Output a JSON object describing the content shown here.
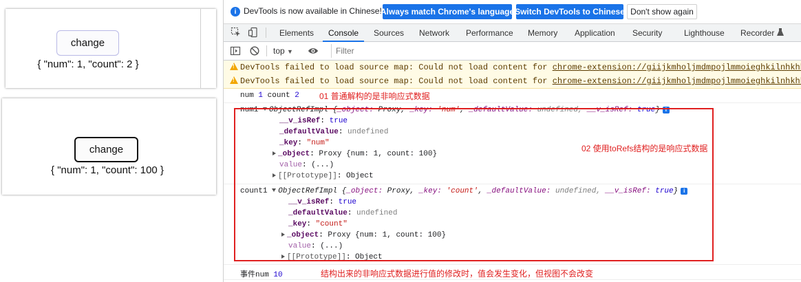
{
  "app": {
    "panel1": {
      "button_label": "change",
      "state_text": "{ \"num\": 1, \"count\": 2 }"
    },
    "panel2": {
      "button_label": "change",
      "state_text": "{ \"num\": 1, \"count\": 100 }"
    }
  },
  "devtools": {
    "infobar": {
      "message": "DevTools is now available in Chinese!",
      "btn_match": "Always match Chrome's language",
      "btn_switch": "Switch DevTools to Chinese",
      "btn_dismiss": "Don't show again"
    },
    "tabs": [
      "Elements",
      "Console",
      "Sources",
      "Network",
      "Performance",
      "Memory",
      "Application",
      "Security",
      "Lighthouse",
      "Recorder"
    ],
    "active_tab": "Console",
    "toolbar": {
      "context": "top",
      "filter_placeholder": "Filter"
    },
    "warnings": [
      {
        "prefix": "DevTools failed to load source map: Could not load content for ",
        "link": "chrome-extension://giijkmholjmdmpojlmmoieghkilnhkhb/static/js"
      },
      {
        "prefix": "DevTools failed to load source map: Could not load content for ",
        "link": "chrome-extension://giijkmholjmdmpojlmmoieghkilnhkhb/static/js"
      }
    ],
    "log1": {
      "label_num": "num",
      "num_val": "1",
      "label_count": "count",
      "count_val": "2"
    },
    "num1": {
      "label": "num1",
      "summary_class": "ObjectRefImpl",
      "summary_obj": "_object:",
      "summary_proxy": "Proxy,",
      "summary_key": "_key:",
      "summary_key_val": "'num'",
      "summary_default": "_defaultValue:",
      "summary_default_val": "undefined,",
      "summary_isref": "__v_isRef:",
      "summary_isref_val": "true",
      "isref_key": "__v_isRef",
      "isref_val": "true",
      "default_key": "_defaultValue",
      "default_val": "undefined",
      "key_key": "_key",
      "key_val": "\"num\"",
      "object_key": "_object",
      "object_val": "Proxy {num: 1, count: 100}",
      "value_key": "value",
      "value_val": "(...)",
      "proto_key": "[[Prototype]]",
      "proto_val": "Object"
    },
    "count1": {
      "label": "count1",
      "summary_class": "ObjectRefImpl",
      "summary_obj": "_object:",
      "summary_proxy": "Proxy,",
      "summary_key": "_key:",
      "summary_key_val": "'count'",
      "summary_default": "_defaultValue:",
      "summary_default_val": "undefined,",
      "summary_isref": "__v_isRef:",
      "summary_isref_val": "true",
      "isref_key": "__v_isRef",
      "isref_val": "true",
      "default_key": "_defaultValue",
      "default_val": "undefined",
      "key_key": "_key",
      "key_val": "\"count\"",
      "object_key": "_object",
      "object_val": "Proxy {num: 1, count: 100}",
      "value_key": "value",
      "value_val": "(...)",
      "proto_key": "[[Prototype]]",
      "proto_val": "Object"
    },
    "log_event": {
      "label": "事件num",
      "val": "10"
    },
    "annotations": {
      "a1": "01    普通解构的是非响应式数据",
      "a2": "02 使用toRefs结构的是响应式数据",
      "a3": "结构出来的非响应式数据进行值的修改时，值会发生变化，但视图不会改变"
    },
    "colors": {
      "accent": "#1a73e8",
      "annotation": "#e02020",
      "warning_bg": "#fffbe5"
    }
  }
}
